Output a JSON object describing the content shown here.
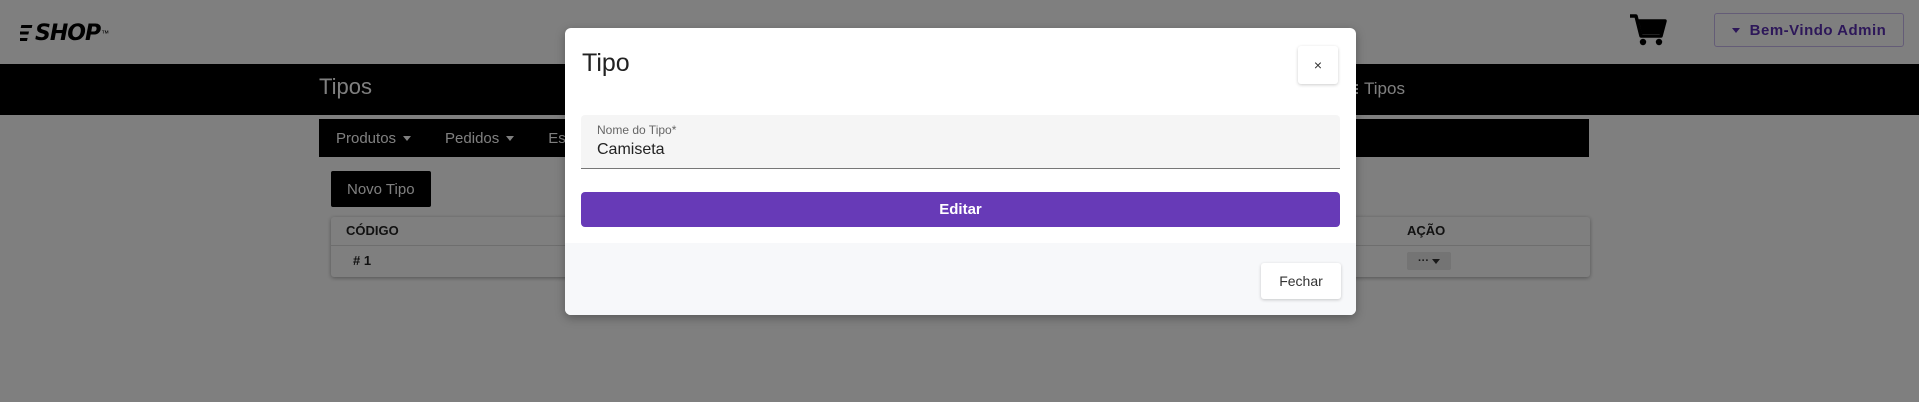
{
  "header": {
    "logo_text": "SHOP",
    "logo_tm": "™",
    "cart_icon": "cart-icon",
    "welcome_label": "Bem-Vindo Admin"
  },
  "titlebar": {
    "title": "Tipos",
    "breadcrumb_current": "Tipos",
    "breadcrumb_icon": "list-icon"
  },
  "subnav": {
    "items": [
      {
        "label": "Produtos"
      },
      {
        "label": "Pedidos"
      },
      {
        "label": "Es"
      }
    ]
  },
  "main": {
    "new_button_label": "Novo Tipo",
    "table": {
      "columns": {
        "code": "CÓDIGO",
        "action": "AÇÃO"
      },
      "rows": [
        {
          "code": "# 1",
          "action_label": "···"
        }
      ]
    }
  },
  "modal": {
    "title": "Tipo",
    "close_label": "×",
    "field": {
      "label": "Nome do Tipo*",
      "value": "Camiseta"
    },
    "submit_label": "Editar",
    "footer_close_label": "Fechar"
  },
  "colors": {
    "accent": "#673ab7",
    "navbar": "#000000",
    "backdrop": "rgba(0,0,0,0.5)"
  }
}
